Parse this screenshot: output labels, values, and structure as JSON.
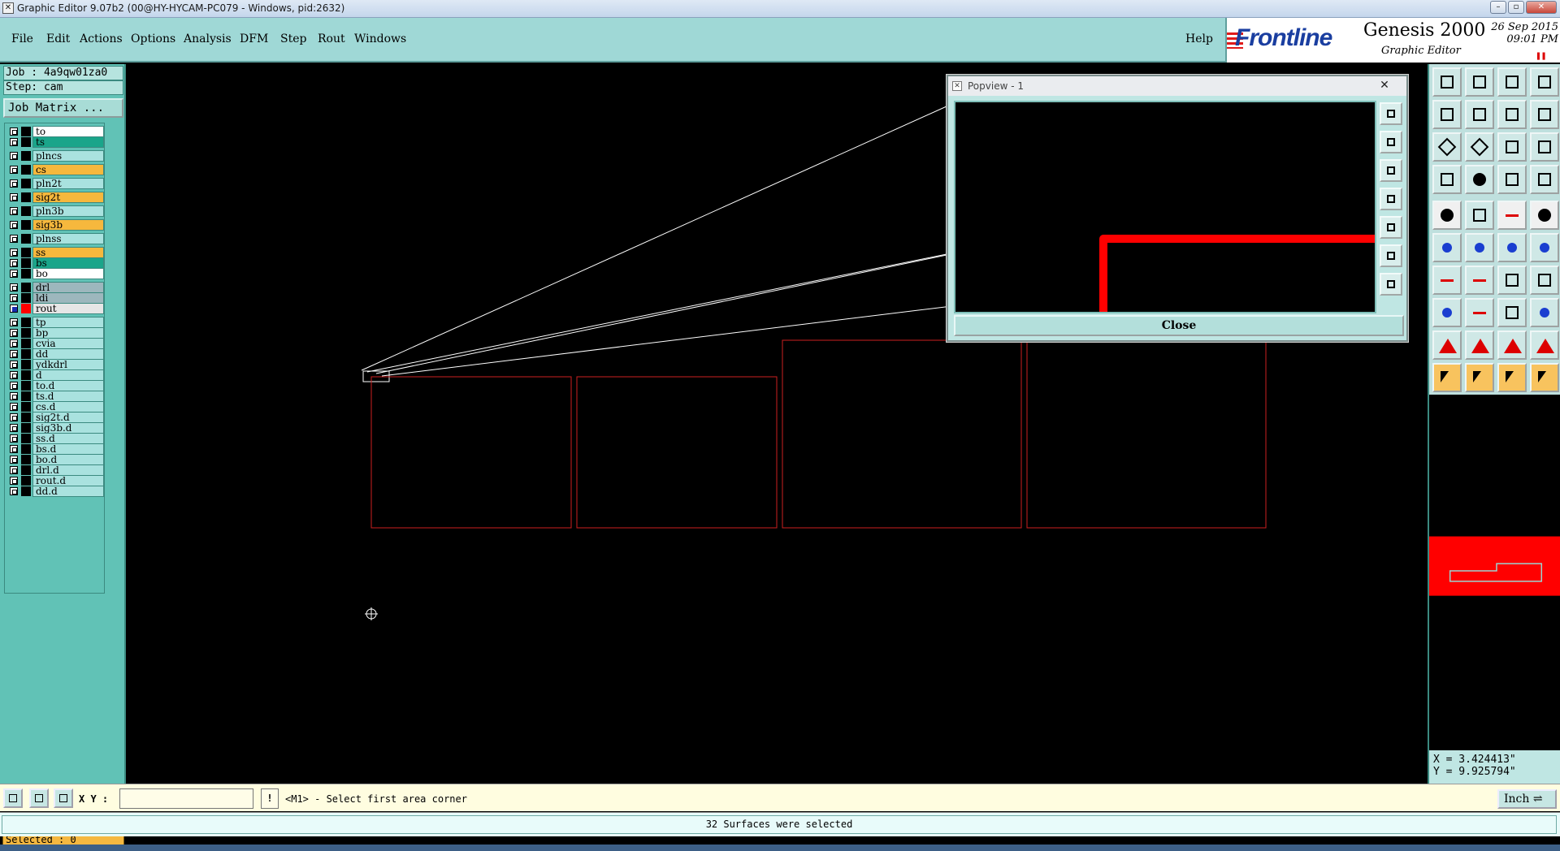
{
  "window": {
    "title": "Graphic Editor 9.07b2 (00@HY-HYCAM-PC079 - Windows, pid:2632)",
    "icon": "x-icon"
  },
  "menu": {
    "items": [
      "File",
      "Edit",
      "Actions",
      "Options",
      "Analysis",
      "DFM",
      "Step",
      "Rout",
      "Windows"
    ],
    "help": "Help"
  },
  "brand": {
    "logo": "Frontline",
    "product": "Genesis 2000",
    "subtitle": "Graphic Editor",
    "date": "26 Sep 2015",
    "time": "09:01 PM"
  },
  "job": {
    "job_label": "Job : 4a9qw01za0",
    "step_label": "Step: cam",
    "matrix_button": "Job Matrix ..."
  },
  "layers": [
    {
      "name": "to",
      "color": "#ffffff",
      "active": false
    },
    {
      "name": "ts",
      "color": "#1aa58a",
      "active": false
    },
    {
      "name": "plncs",
      "color": "#a9e2df",
      "active": false
    },
    {
      "name": "cs",
      "color": "#f6b83d",
      "active": false
    },
    {
      "name": "pln2t",
      "color": "#a9e2df",
      "active": false
    },
    {
      "name": "sig2t",
      "color": "#f6b83d",
      "active": false
    },
    {
      "name": "pln3b",
      "color": "#a9e2df",
      "active": false
    },
    {
      "name": "sig3b",
      "color": "#f6b83d",
      "active": false
    },
    {
      "name": "plnss",
      "color": "#a9e2df",
      "active": false
    },
    {
      "name": "ss",
      "color": "#f6b83d",
      "active": false
    },
    {
      "name": "bs",
      "color": "#1aa58a",
      "active": false
    },
    {
      "name": "bo",
      "color": "#ffffff",
      "active": false
    },
    {
      "name": "drl",
      "color": "#9db7bd",
      "active": false
    },
    {
      "name": "ldi",
      "color": "#9db7bd",
      "active": false
    },
    {
      "name": "rout",
      "color": "#e6e6e6",
      "active": true
    },
    {
      "name": "tp",
      "color": "#a9e2df",
      "active": false
    },
    {
      "name": "bp",
      "color": "#a9e2df",
      "active": false
    },
    {
      "name": "cvia",
      "color": "#a9e2df",
      "active": false
    },
    {
      "name": "dd",
      "color": "#a9e2df",
      "active": false
    },
    {
      "name": "ydkdrl",
      "color": "#a9e2df",
      "active": false
    },
    {
      "name": "d",
      "color": "#a9e2df",
      "active": false
    },
    {
      "name": "to.d",
      "color": "#a9e2df",
      "active": false
    },
    {
      "name": "ts.d",
      "color": "#a9e2df",
      "active": false
    },
    {
      "name": "cs.d",
      "color": "#a9e2df",
      "active": false
    },
    {
      "name": "sig2t.d",
      "color": "#a9e2df",
      "active": false
    },
    {
      "name": "sig3b.d",
      "color": "#a9e2df",
      "active": false
    },
    {
      "name": "ss.d",
      "color": "#a9e2df",
      "active": false
    },
    {
      "name": "bs.d",
      "color": "#a9e2df",
      "active": false
    },
    {
      "name": "bo.d",
      "color": "#a9e2df",
      "active": false
    },
    {
      "name": "drl.d",
      "color": "#a9e2df",
      "active": false
    },
    {
      "name": "rout.d",
      "color": "#a9e2df",
      "active": false
    },
    {
      "name": "dd.d",
      "color": "#a9e2df",
      "active": false
    }
  ],
  "selected_label": "Selected : 0",
  "popview": {
    "title": "Popview - 1",
    "close_x": "✕",
    "close_button": "Close"
  },
  "coords": {
    "x": "X = 3.424413\"",
    "y": "Y = 9.925794\""
  },
  "command": {
    "xy_label": "X Y :",
    "xy_value": "",
    "warn": "!",
    "prompt": "<M1> - Select first area corner",
    "units": "Inch ⇌"
  },
  "status_message": "32 Surfaces were selected",
  "colors": {
    "panel": "#61c2b6",
    "menu": "#9fd8d6",
    "profile_red": "#cc1f1f",
    "route_red": "#ff0000"
  }
}
